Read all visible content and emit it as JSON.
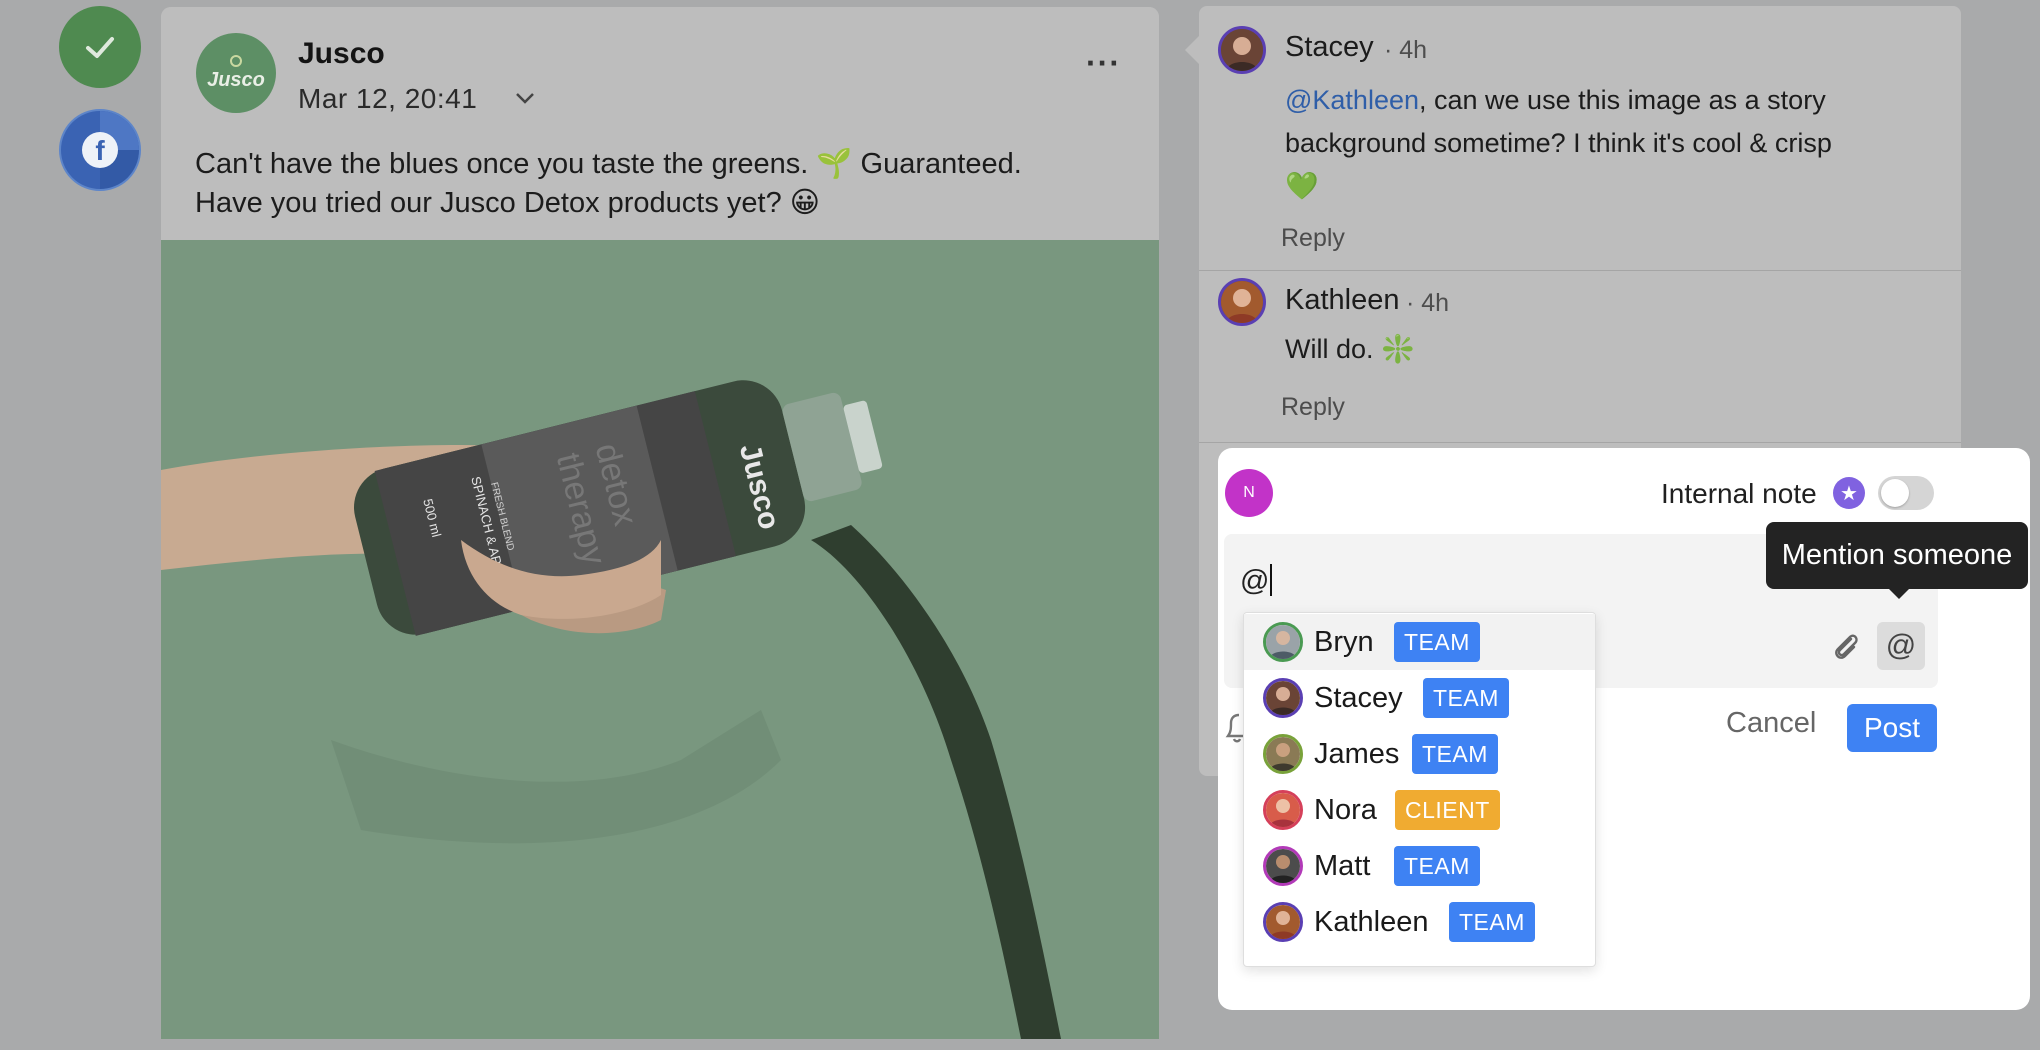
{
  "rail": {
    "approve_icon": "check-icon",
    "network_icon": "facebook-icon"
  },
  "post": {
    "brand_name": "Jusco",
    "avatar_text": "Jusco",
    "date": "Mar 12, 20:41",
    "more": "···",
    "text_line1": "Can't have the blues once you taste the greens. 🌱 Guaranteed.",
    "text_line2": "Have you tried our Jusco Detox products yet? 😀",
    "bottle": {
      "brand": "Jusco",
      "line1": "detox",
      "line2": "therapy",
      "blend": "FRESH BLEND",
      "flavor": "SPINACH & APPLE",
      "volume": "500 ml"
    }
  },
  "comments": [
    {
      "name": "Stacey",
      "time": "· 4h",
      "mention": "@Kathleen",
      "text_after_mention": ", can we use this image as a story",
      "text_line2": "background sometime? I think it's cool & crisp",
      "text_line3": "💚",
      "reply": "Reply"
    },
    {
      "name": "Kathleen",
      "time": "· 4h",
      "text": "Will do. ❇️",
      "reply": "Reply"
    }
  ],
  "composer": {
    "user_initial": "N",
    "internal_note_label": "Internal note",
    "internal_note_on": false,
    "input_value": "@",
    "cancel_label": "Cancel",
    "post_label": "Post"
  },
  "tooltip": {
    "text": "Mention someone"
  },
  "mention_options": [
    {
      "name": "Bryn",
      "role": "TEAM"
    },
    {
      "name": "Stacey",
      "role": "TEAM"
    },
    {
      "name": "James",
      "role": "TEAM"
    },
    {
      "name": "Nora",
      "role": "CLIENT"
    },
    {
      "name": "Matt",
      "role": "TEAM"
    },
    {
      "name": "Kathleen",
      "role": "TEAM"
    }
  ],
  "colors": {
    "team_badge": "#3e82f3",
    "client_badge": "#f0ab31",
    "post_button": "#3e82f3",
    "approve": "#4f8a50",
    "internal_note_badge": "#8062e0"
  }
}
